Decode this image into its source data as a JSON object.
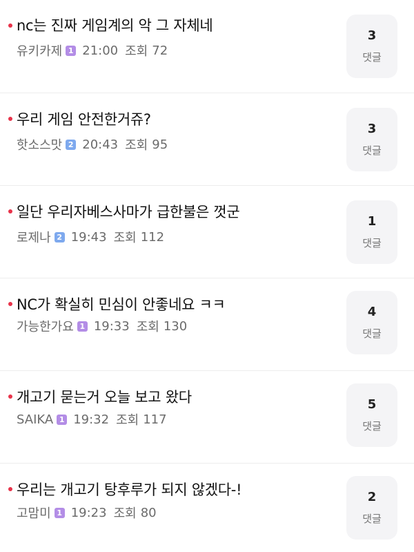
{
  "colors": {
    "bullet": "#e8334a",
    "badge_purple": "#b38de6",
    "badge_blue": "#7ea9ee"
  },
  "views_label": "조회",
  "comment_label": "댓글",
  "posts": [
    {
      "title": "nc는 진짜 게임계의 악 그 자체네",
      "author": "유키카제",
      "level": "1",
      "badge_color": "#b38de6",
      "time": "21:00",
      "views": "72",
      "comments": "3"
    },
    {
      "title": "우리 게임 안전한거쥬?",
      "author": "핫소스맛",
      "level": "2",
      "badge_color": "#7ea9ee",
      "time": "20:43",
      "views": "95",
      "comments": "3"
    },
    {
      "title": "일단 우리자베스사마가 급한불은 껏군",
      "author": "로제나",
      "level": "2",
      "badge_color": "#7ea9ee",
      "time": "19:43",
      "views": "112",
      "comments": "1"
    },
    {
      "title": "NC가 확실히 민심이 안좋네요 ㅋㅋ",
      "author": "가능한가요",
      "level": "1",
      "badge_color": "#b38de6",
      "time": "19:33",
      "views": "130",
      "comments": "4"
    },
    {
      "title": "개고기 묻는거 오늘 보고 왔다",
      "author": "SAIKA",
      "level": "1",
      "badge_color": "#b38de6",
      "time": "19:32",
      "views": "117",
      "comments": "5"
    },
    {
      "title": "우리는 개고기 탕후루가 되지 않겠다-!",
      "author": "고맘미",
      "level": "1",
      "badge_color": "#b38de6",
      "time": "19:23",
      "views": "80",
      "comments": "2"
    }
  ]
}
